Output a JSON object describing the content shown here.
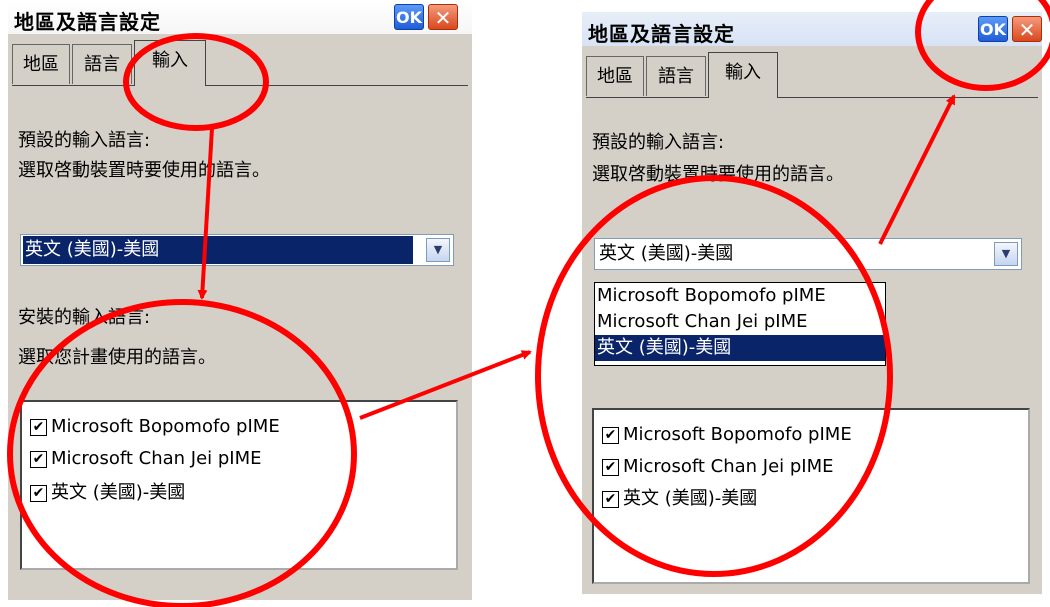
{
  "left": {
    "title": "地區及語言設定",
    "ok_label": "OK",
    "close_label": "✕",
    "tabs": [
      "地區",
      "語言",
      "輸入"
    ],
    "default_heading": "預設的輸入語言:",
    "default_desc": "選取啓動裝置時要使用的語言。",
    "default_value": "英文 (美國)-美國",
    "installed_heading": "安裝的輸入語言:",
    "installed_desc": "選取您計畫使用的語言。",
    "installed_items": [
      "Microsoft Bopomofo pIME",
      "Microsoft Chan Jei pIME",
      "英文 (美國)-美國"
    ]
  },
  "right": {
    "title": "地區及語言設定",
    "ok_label": "OK",
    "close_label": "✕",
    "tabs": [
      "地區",
      "語言",
      "輸入"
    ],
    "default_heading": "預設的輸入語言:",
    "default_desc": "選取啓動裝置時要使用的語言。",
    "default_value": "英文 (美國)-美國",
    "dropdown_options": [
      "Microsoft Bopomofo pIME",
      "Microsoft Chan Jei pIME",
      "英文 (美國)-美國"
    ],
    "installed_items": [
      "Microsoft Bopomofo pIME",
      "Microsoft Chan Jei pIME",
      "英文 (美國)-美國"
    ]
  },
  "icons": {
    "dropdown_arrow": "chevron-down-icon",
    "check": "✔"
  },
  "colors": {
    "annotation_red": "#ff0000",
    "selection_blue": "#0a246a",
    "ok_blue": "#215dd6",
    "close_orange": "#d9481f"
  }
}
